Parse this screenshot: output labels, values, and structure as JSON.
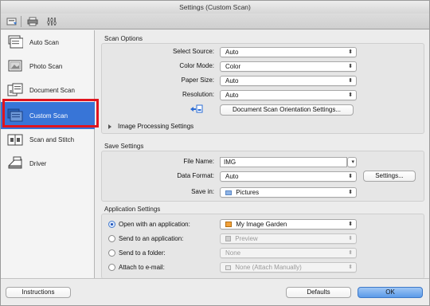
{
  "window": {
    "title": "Settings (Custom Scan)"
  },
  "toolbar": {
    "icons": [
      "scan-settings-icon",
      "printer-icon",
      "general-settings-icon"
    ]
  },
  "sidebar": {
    "items": [
      {
        "label": "Auto Scan",
        "icon": "auto-scan-icon",
        "selected": false
      },
      {
        "label": "Photo Scan",
        "icon": "photo-scan-icon",
        "selected": false
      },
      {
        "label": "Document Scan",
        "icon": "document-scan-icon",
        "selected": false
      },
      {
        "label": "Custom Scan",
        "icon": "custom-scan-icon",
        "selected": true
      },
      {
        "label": "Scan and Stitch",
        "icon": "scan-and-stitch-icon",
        "selected": false
      },
      {
        "label": "Driver",
        "icon": "driver-icon",
        "selected": false
      }
    ],
    "selected_color": "#3875d7",
    "highlight_color": "#e0141e"
  },
  "scan_options": {
    "title": "Scan Options",
    "select_source": {
      "label": "Select Source:",
      "value": "Auto"
    },
    "color_mode": {
      "label": "Color Mode:",
      "value": "Color"
    },
    "paper_size": {
      "label": "Paper Size:",
      "value": "Auto"
    },
    "resolution": {
      "label": "Resolution:",
      "value": "Auto"
    },
    "orientation_button": "Document Scan Orientation Settings...",
    "image_processing": "Image Processing Settings"
  },
  "save_settings": {
    "title": "Save Settings",
    "file_name": {
      "label": "File Name:",
      "value": "IMG"
    },
    "data_format": {
      "label": "Data Format:",
      "value": "Auto"
    },
    "settings_button": "Settings...",
    "save_in": {
      "label": "Save in:",
      "value": "Pictures"
    }
  },
  "application_settings": {
    "title": "Application Settings",
    "options": [
      {
        "label": "Open with an application:",
        "value": "My Image Garden",
        "selected": true,
        "enabled": true
      },
      {
        "label": "Send to an application:",
        "value": "Preview",
        "selected": false,
        "enabled": false
      },
      {
        "label": "Send to a folder:",
        "value": "None",
        "selected": false,
        "enabled": false
      },
      {
        "label": "Attach to e-mail:",
        "value": "None (Attach Manually)",
        "selected": false,
        "enabled": false
      }
    ]
  },
  "footer": {
    "instructions": "Instructions",
    "defaults": "Defaults",
    "ok": "OK"
  }
}
